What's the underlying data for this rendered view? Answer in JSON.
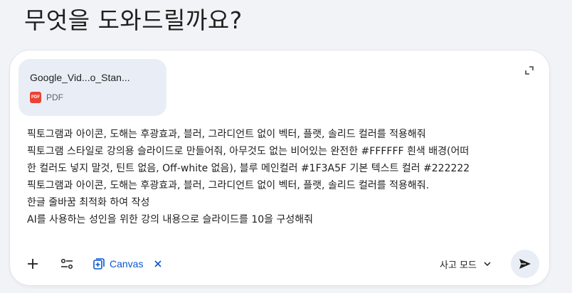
{
  "heading": "무엇을 도와드릴까요?",
  "attachment": {
    "file_name": "Google_Vid...o_Stan...",
    "file_type": "PDF",
    "icon": "pdf-icon",
    "icon_text": "PDF"
  },
  "prompt": {
    "lines": [
      "픽토그램과 아이콘, 도해는 후광효과, 블러, 그라디언트 없이 벡터, 플랫, 솔리드 컬러를 적용해줘",
      "픽토그램 스타일로 강의용 슬라이드로 만들어줘, 아무것도 없는 비어있는 완전한 #FFFFFF 흰색 배경(어떠",
      "한 컬러도 넣지 말것, 틴트 없음, Off-white 없음), 블루 메인컬러 #1F3A5F 기본 텍스트 컬러 #222222",
      "픽토그램과 아이콘, 도해는 후광효과, 블러, 그라디언트 없이 벡터, 플랫, 솔리드 컬러를 적용해줘.",
      "한글 줄바꿈 최적화 하여 작성",
      "AI를 사용하는 성인을 위한 강의 내용으로 슬라이드를 10을 구성해줘"
    ]
  },
  "toolbar": {
    "add_icon": "plus-icon",
    "tools_icon": "tools-icon",
    "canvas_label": "Canvas",
    "canvas_icon": "canvas-icon",
    "canvas_close_icon": "close-icon",
    "mode_label": "사고 모드",
    "mode_icon": "chevron-down-icon",
    "send_icon": "send-icon"
  },
  "colors": {
    "background": "#f1f3f6",
    "composer": "#ffffff",
    "chip": "#e9eef6",
    "accent": "#0b57d0",
    "pdf_red": "#ea4335"
  }
}
